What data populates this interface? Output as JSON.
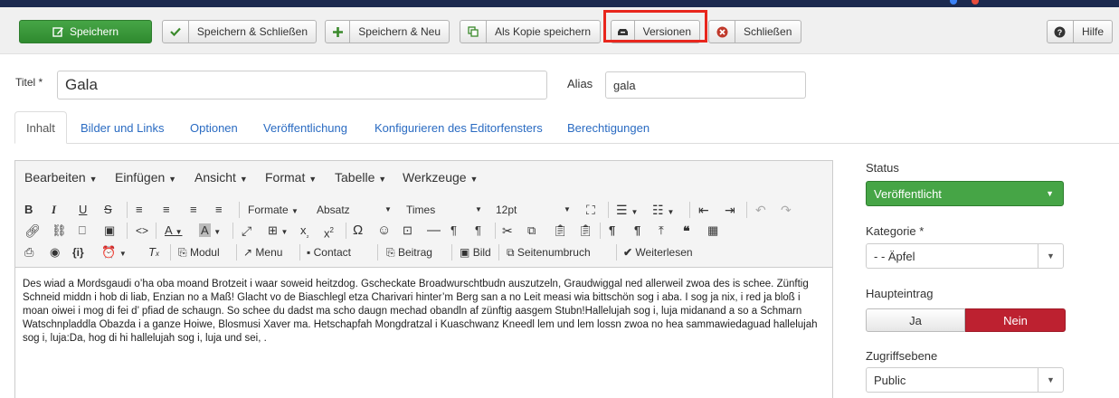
{
  "toolbar": {
    "save": "Speichern",
    "save_close": "Speichern & Schließen",
    "save_new": "Speichern & Neu",
    "save_copy": "Als Kopie speichern",
    "versions": "Versionen",
    "close": "Schließen",
    "help": "Hilfe"
  },
  "form": {
    "title_label": "Titel *",
    "title_value": "Gala",
    "alias_label": "Alias",
    "alias_value": "gala"
  },
  "tabs": [
    "Inhalt",
    "Bilder und Links",
    "Optionen",
    "Veröffentlichung",
    "Konfigurieren des Editorfensters",
    "Berechtigungen"
  ],
  "editor": {
    "menus": [
      "Bearbeiten",
      "Einfügen",
      "Ansicht",
      "Format",
      "Tabelle",
      "Werkzeuge"
    ],
    "formats_label": "Formate",
    "block_select": "Absatz",
    "font_select": "Times",
    "size_select": "12pt",
    "buttons": {
      "module": "Modul",
      "menu": "Menu",
      "contact": "Contact",
      "article": "Beitrag",
      "image": "Bild",
      "pagebreak": "Seitenumbruch",
      "readmore": "Weiterlesen"
    },
    "content": "Des wiad a Mordsgaudi o’ha oba moand Brotzeit i waar soweid heitzdog. Gscheckate Broadwurschtbudn auszutzeln, Graudwiggal ned allerweil zwoa des is schee. Zünftig Schneid middn i hob di liab, Enzian no a Maß! Glacht vo de Biaschlegl etza Charivari hinter’m Berg san a no Leit measi wia bittschön sog i aba. I sog ja nix, i red ja bloß i moan oiwei i mog di fei d’ pfiad de schaugn. So schee du dadst ma scho daugn mechad obandln af zünftig aasgem Stubn!Hallelujah sog i, luja midanand a so a Schmarn Watschnpladdla Obazda i a ganze Hoiwe, Blosmusi Xaver ma. Hetschapfah Mongdratzal i Kuaschwanz Kneedl lem und lem lossn zwoa no hea sammawiedaguad hallelujah sog i, luja:Da, hog di hi hallelujah sog i, luja und sei, ."
  },
  "sidebar": {
    "status_label": "Status",
    "status_value": "Veröffentlicht",
    "category_label": "Kategorie *",
    "category_value": "- - Äpfel",
    "featured_label": "Haupteintrag",
    "featured_yes": "Ja",
    "featured_no": "Nein",
    "featured_active": "Nein",
    "access_label": "Zugriffsebene",
    "access_value": "Public"
  },
  "colors": {
    "save_green": "#46a546",
    "highlight_red": "#e8261d",
    "active_no_red": "#bd2130",
    "link_blue": "#2a6bc2"
  }
}
